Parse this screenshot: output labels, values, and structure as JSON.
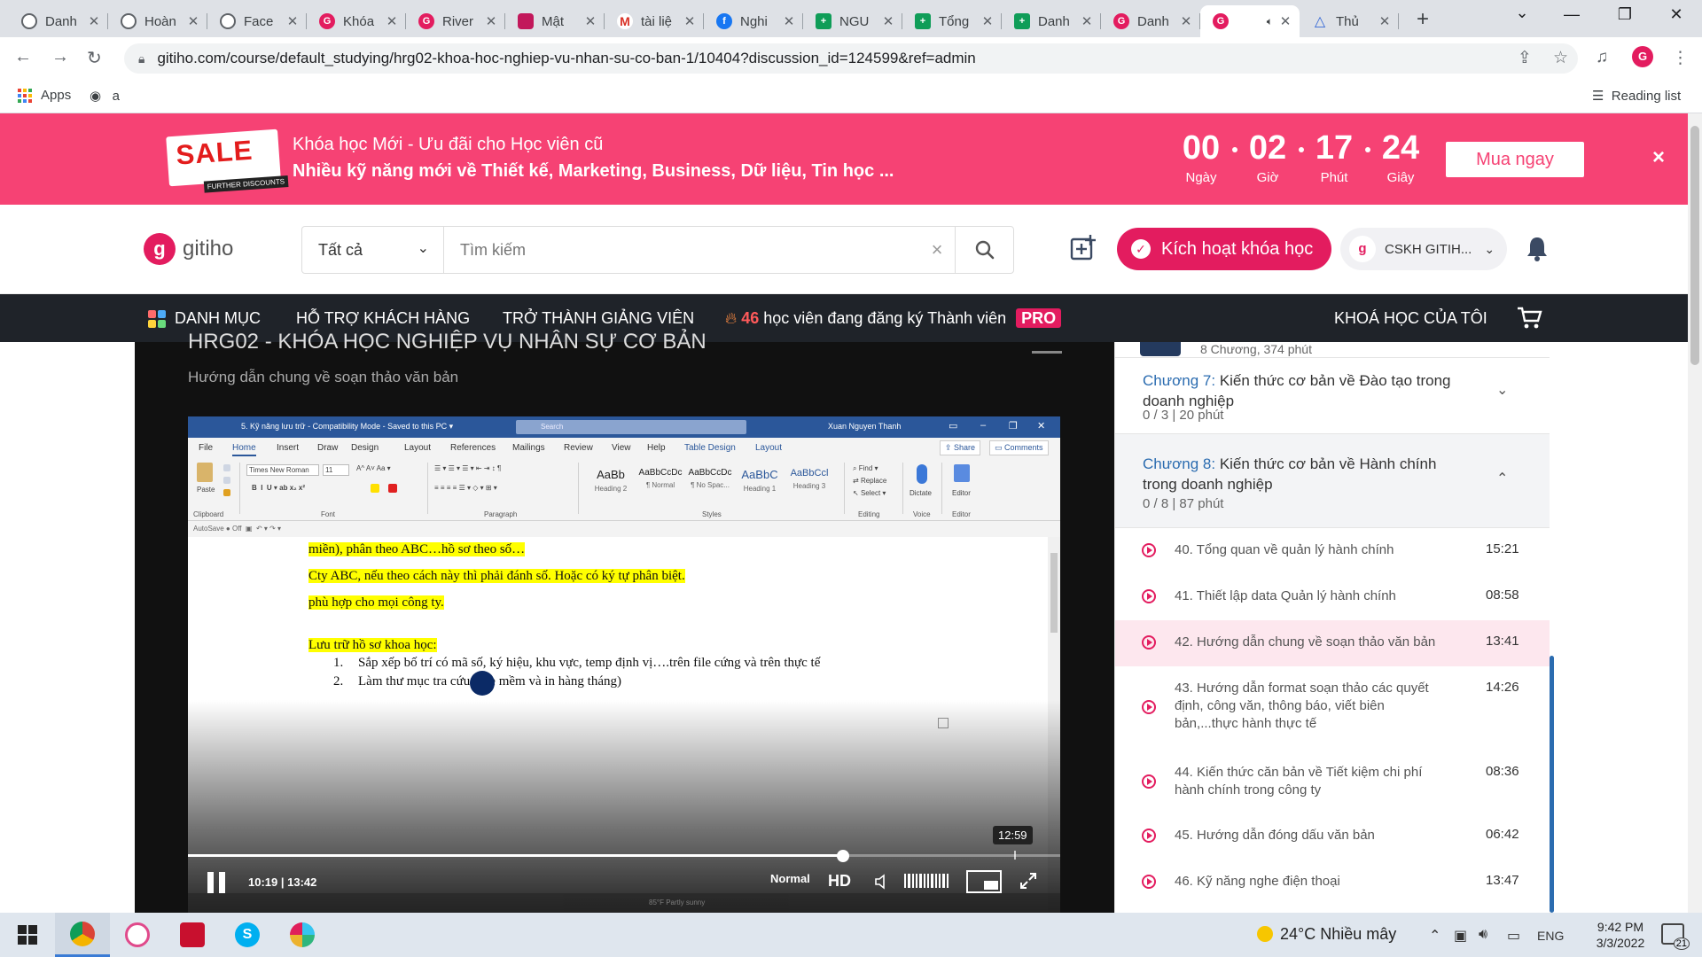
{
  "browser": {
    "tabs": [
      {
        "title": "Danh",
        "icon": "globe-icon",
        "fav": "globe"
      },
      {
        "title": "Hoàn",
        "icon": "globe-icon",
        "fav": "globe"
      },
      {
        "title": "Face",
        "icon": "globe-icon",
        "fav": "globe"
      },
      {
        "title": "Khóa",
        "icon": "gitiho-icon",
        "fav": "gitiho"
      },
      {
        "title": "River",
        "icon": "gitiho-icon",
        "fav": "gitiho"
      },
      {
        "title": "Mật",
        "icon": "mat-icon",
        "fav": "moon"
      },
      {
        "title": "tài liệ",
        "icon": "gmail-icon",
        "fav": "gmail"
      },
      {
        "title": "Nghi",
        "icon": "facebook-icon",
        "fav": "fb"
      },
      {
        "title": "NGU",
        "icon": "sheets-icon",
        "fav": "sheets"
      },
      {
        "title": "Tổng",
        "icon": "sheets-icon",
        "fav": "sheets"
      },
      {
        "title": "Danh",
        "icon": "sheets-icon",
        "fav": "sheets"
      },
      {
        "title": "Danh",
        "icon": "gitiho-icon",
        "fav": "gitiho"
      },
      {
        "title": "",
        "icon": "gitiho-icon",
        "fav": "gitiho",
        "active": true,
        "audio": true
      },
      {
        "title": "Thủ",
        "icon": "drive-icon",
        "fav": "tri"
      }
    ],
    "url": "gitiho.com/course/default_studying/hrg02-khoa-hoc-nghiep-vu-nhan-su-co-ban-1/10404?discussion_id=124599&ref=admin",
    "bookmarks": {
      "apps_label": "Apps",
      "item_a": "a",
      "reading_list": "Reading list"
    }
  },
  "sale_banner": {
    "badge": "SALE",
    "badge_small": "FURTHER DISCOUNTS",
    "line1": "Khóa học Mới - Ưu đãi cho Học viên cũ",
    "line2": "Nhiều kỹ năng mới về Thiết kế, Marketing, Business, Dữ liệu, Tin học ...",
    "countdown": [
      {
        "value": "00",
        "label": "Ngày"
      },
      {
        "value": "02",
        "label": "Giờ"
      },
      {
        "value": "17",
        "label": "Phút"
      },
      {
        "value": "24",
        "label": "Giây"
      }
    ],
    "buy_label": "Mua ngay",
    "close": "×"
  },
  "header": {
    "logo_text": "gitiho",
    "search_category": "Tất cả",
    "search_placeholder": "Tìm kiếm",
    "activate_label": "Kích hoạt khóa học",
    "account_label": "CSKH GITIH...",
    "account_sub": "gitiho"
  },
  "nav": {
    "categories": "DANH MỤC",
    "support": "HỖ TRỢ KHÁCH HÀNG",
    "teacher": "TRỞ THÀNH GIẢNG VIÊN",
    "pro_count": "46",
    "pro_text": "học viên đang đăng ký Thành viên",
    "pro_badge": "PRO",
    "my_courses": "KHOÁ HỌC CỦA TÔI"
  },
  "player": {
    "course_title": "HRG02 - KHÓA HỌC NGHIỆP VỤ NHÂN SỰ CƠ BẢN",
    "lesson_subtitle": "Hướng dẫn chung về soạn thảo văn bản",
    "current_time": "10:19",
    "duration": "13:42",
    "time_separator": "|",
    "progress_fraction": 0.751,
    "hover_time": "12:59",
    "speed": "Normal",
    "quality": "HD"
  },
  "word": {
    "doc_title": "5. Kỹ năng lưu trữ - Compatibility Mode - Saved to this PC ▾",
    "search": "Search",
    "user": "Xuan Nguyen Thanh",
    "menus": [
      "File",
      "Home",
      "Insert",
      "Draw",
      "Design",
      "Layout",
      "References",
      "Mailings",
      "Review",
      "View",
      "Help",
      "Table Design",
      "Layout"
    ],
    "share": "Share",
    "comments": "Comments",
    "groups": [
      "Clipboard",
      "Font",
      "Paragraph",
      "Styles",
      "Editing",
      "Voice",
      "Editor"
    ],
    "styles": [
      {
        "sample": "AaBb",
        "name": "Heading 2"
      },
      {
        "sample": "AaBbCcDc",
        "name": "¶ Normal"
      },
      {
        "sample": "AaBbCcDc",
        "name": "¶ No Spac..."
      },
      {
        "sample": "AaBbC",
        "name": "Heading 1"
      },
      {
        "sample": "AaBbCcl",
        "name": "Heading 3"
      }
    ],
    "font_name": "Times New Roman",
    "font_size": "11",
    "paste": "Paste",
    "find": "Find",
    "replace": "Replace",
    "select": "Select",
    "dictate": "Dictate",
    "editor": "Editor",
    "autosave": "AutoSave",
    "autosave_state": "Off",
    "lines": [
      "miền), phân theo ABC…hồ sơ theo số…",
      "Cty ABC, nếu theo cách này thì phải đánh số. Hoặc có ký tự phân biệt.",
      "phù hợp cho mọi công ty.",
      "Lưu trữ hồ sơ khoa học:"
    ],
    "list": [
      {
        "n": "1.",
        "text": "Sắp xếp bố trí có mã số, ký hiệu, khu vực, temp định vị….trên file cứng và trên thực tế"
      },
      {
        "n": "2.",
        "text": "Làm thư mục tra cứu (file mềm và in hàng tháng)"
      }
    ],
    "taskbar_weather": "85°F  Partly sunny"
  },
  "sidebar": {
    "prev_chapter_meta": "8 Chương, 374 phút",
    "chapters": [
      {
        "num": "Chương 7:",
        "title": "Kiến thức cơ bản về Đào tạo trong doanh nghiệp",
        "meta": "0 / 3   |   20 phút",
        "chev": "⌄"
      },
      {
        "num": "Chương 8:",
        "title": "Kiến thức cơ bản về Hành chính trong doanh nghiệp",
        "meta": "0 / 8   |   87 phút",
        "chev": "⌃"
      }
    ],
    "lessons": [
      {
        "title": "40. Tổng quan về quản lý hành chính",
        "duration": "15:21"
      },
      {
        "title": "41. Thiết lập data Quản lý hành chính",
        "duration": "08:58"
      },
      {
        "title": "42. Hướng dẫn chung về soạn thảo văn bản",
        "duration": "13:41",
        "active": true
      },
      {
        "title": "43. Hướng dẫn format soạn thảo các quyết định, công văn, thông báo, viết biên bản,...thực hành thực tế",
        "duration": "14:26"
      },
      {
        "title": "44. Kiến thức căn bản về Tiết kiệm chi phí hành chính trong công ty",
        "duration": "08:36"
      },
      {
        "title": "45. Hướng dẫn đóng dấu văn bản",
        "duration": "06:42"
      },
      {
        "title": "46. Kỹ năng nghe điện thoại",
        "duration": "13:47"
      }
    ]
  },
  "taskbar": {
    "weather": "24°C  Nhiều mây",
    "lang": "ENG",
    "time": "9:42 PM",
    "date": "3/3/2022",
    "notifications": "21"
  },
  "colors": {
    "brand": "#e31c5f",
    "sale_bg": "#f64274",
    "nav_bg": "#1f2329",
    "link_blue": "#2b6cb0"
  }
}
